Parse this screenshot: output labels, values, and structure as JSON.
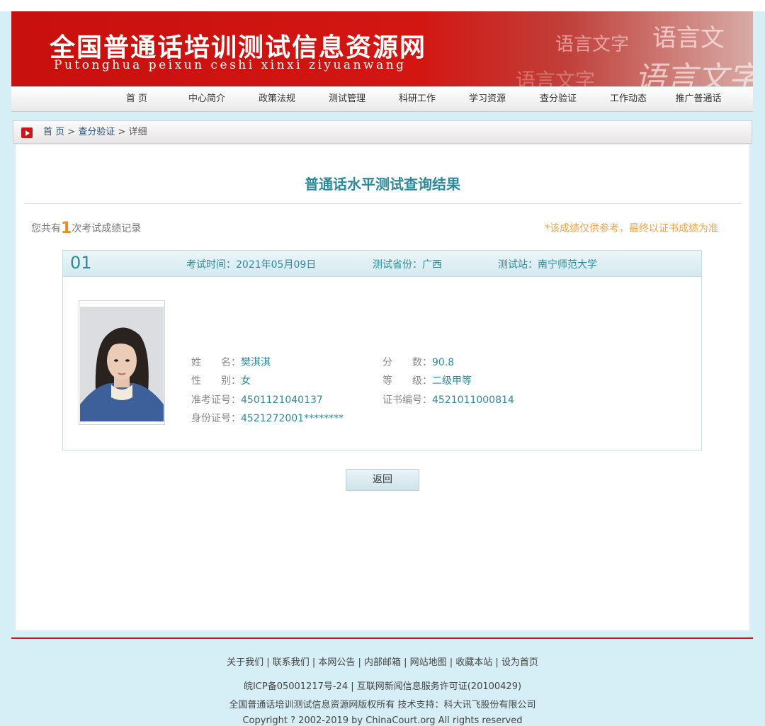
{
  "banner": {
    "title_cn": "全国普通话培训测试信息资源网",
    "title_en": "Putonghua peixun ceshi xinxi ziyuanwang",
    "decor": [
      "语言文字",
      "语言文",
      "语言文字",
      "语言文字"
    ]
  },
  "nav": [
    "首 页",
    "中心简介",
    "政策法规",
    "测试管理",
    "科研工作",
    "学习资源",
    "查分验证",
    "工作动态",
    "推广普通话"
  ],
  "breadcrumb": {
    "home": "首 页",
    "sep1": " > ",
    "crumb2": "查分验证",
    "sep2": " > ",
    "current": "详细"
  },
  "result": {
    "heading": "普通话水平测试查询结果",
    "count_prefix": "您共有",
    "count": "1",
    "count_suffix": "次考试成绩记录",
    "notice": "*该成绩仅供参考，最终以证书成绩为准"
  },
  "record": {
    "no": "01",
    "exam_time_label": "考试时间：",
    "exam_time": "2021年05月09日",
    "province_label": "测试省份：",
    "province": "广西",
    "station_label": "测试站：",
    "station": "南宁师范大学",
    "name_label": "姓　　名：",
    "name": "樊淇淇",
    "gender_label": "性　　别：",
    "gender": "女",
    "ticket_label": "准考证号：",
    "ticket": "4501121040137",
    "id_label": "身份证号：",
    "id": "4521272001********",
    "score_label": "分　　数：",
    "score": "90.8",
    "level_label": "等　　级：",
    "level": "二级甲等",
    "cert_label": "证书编号：",
    "cert": "4521011000814"
  },
  "back_button": "返回",
  "footer": {
    "links": "关于我们 | 联系我们 | 本网公告 | 内部邮箱 | 网站地图 | 收藏本站 | 设为首页",
    "icp": "皖ICP备05001217号-24 | 互联网新闻信息服务许可证(20100429)",
    "rights": "全国普通话培训测试信息资源网版权所有  技术支持：科大讯飞股份有限公司",
    "copyright": "Copyright ? 2002-2019 by ChinaCourt.org All rights reserved"
  },
  "colors": {
    "brand_red": "#c9161a",
    "accent_teal": "#2e8a9a",
    "notice_orange": "#f0a24a"
  }
}
